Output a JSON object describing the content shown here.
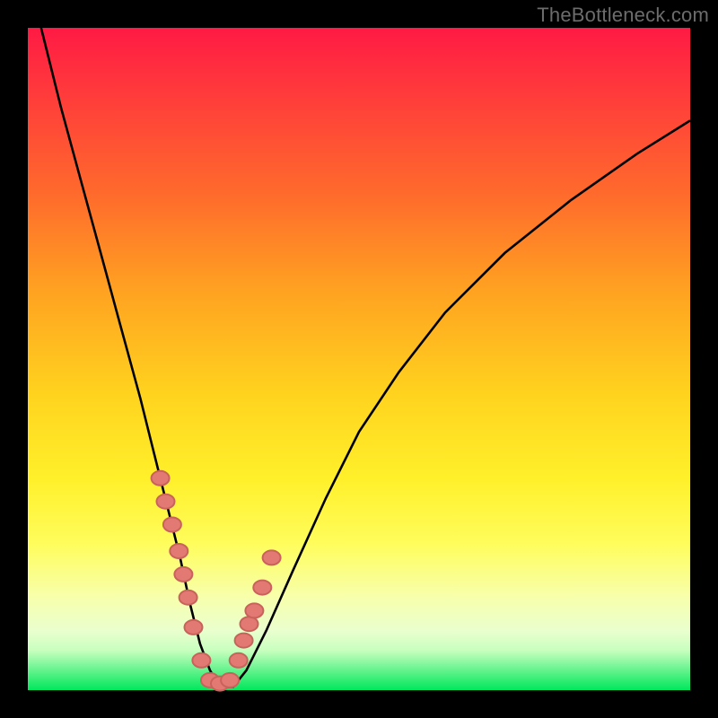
{
  "attribution": "TheBottleneck.com",
  "colors": {
    "background_frame": "#000000",
    "gradient_top": "#ff1a44",
    "gradient_bottom": "#00e75b",
    "curve": "#000000",
    "point_fill": "#e27a73",
    "point_stroke": "#c9625b"
  },
  "chart_data": {
    "type": "line",
    "title": "",
    "xlabel": "",
    "ylabel": "",
    "xlim": [
      0,
      100
    ],
    "ylim": [
      0,
      100
    ],
    "curve": {
      "x": [
        2,
        5,
        8,
        11,
        14,
        17,
        19,
        21,
        23,
        24.5,
        26,
        27.5,
        29,
        31,
        33,
        36,
        40,
        45,
        50,
        56,
        63,
        72,
        82,
        92,
        100
      ],
      "y": [
        100,
        88,
        77,
        66,
        55,
        44,
        36,
        28,
        20,
        13,
        7,
        3,
        0.5,
        0.5,
        3,
        9,
        18,
        29,
        39,
        48,
        57,
        66,
        74,
        81,
        86
      ]
    },
    "series": [
      {
        "name": "highlighted-points",
        "x": [
          20.0,
          20.8,
          21.8,
          22.8,
          23.5,
          24.2,
          25.0,
          26.2,
          27.5,
          29.0,
          30.5,
          31.8,
          32.6,
          33.4,
          34.2,
          35.4,
          36.8
        ],
        "y": [
          32.0,
          28.5,
          25.0,
          21.0,
          17.5,
          14.0,
          9.5,
          4.5,
          1.5,
          1.0,
          1.5,
          4.5,
          7.5,
          10.0,
          12.0,
          15.5,
          20.0
        ]
      }
    ],
    "notes": "Axes are implied (no ticks or labels shown). x roughly 0–100 left→right, y roughly 0–100 bottom→top. Curve is a sharp V/funnel with minimum near x≈29. Highlighted points cluster along the lower part of both branches."
  }
}
